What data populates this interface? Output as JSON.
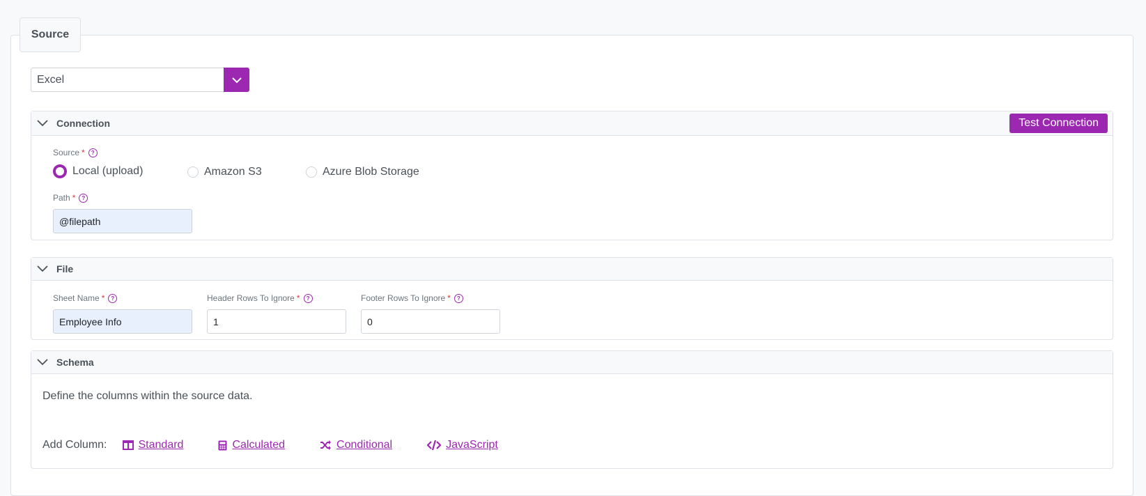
{
  "legend": "Source",
  "source_type": {
    "selected": "Excel"
  },
  "connection": {
    "title": "Connection",
    "test_button": "Test Connection",
    "source_label": "Source",
    "radio_options": [
      {
        "label": "Local (upload)",
        "selected": true
      },
      {
        "label": "Amazon S3",
        "selected": false
      },
      {
        "label": "Azure Blob Storage",
        "selected": false
      }
    ],
    "path_label": "Path",
    "path_value": "@filepath"
  },
  "file": {
    "title": "File",
    "sheet_name_label": "Sheet Name",
    "sheet_name_value": "Employee Info",
    "header_rows_label": "Header Rows To Ignore",
    "header_rows_value": "1",
    "footer_rows_label": "Footer Rows To Ignore",
    "footer_rows_value": "0"
  },
  "schema": {
    "title": "Schema",
    "description": "Define the columns within the source data.",
    "add_column_label": "Add Column:",
    "links": [
      "Standard",
      "Calculated",
      "Conditional",
      "JavaScript"
    ]
  },
  "required_mark": "*",
  "help_glyph": "?",
  "colors": {
    "accent": "#9c27b0",
    "required": "#dc3545",
    "filled_input": "#e8f0fe"
  }
}
